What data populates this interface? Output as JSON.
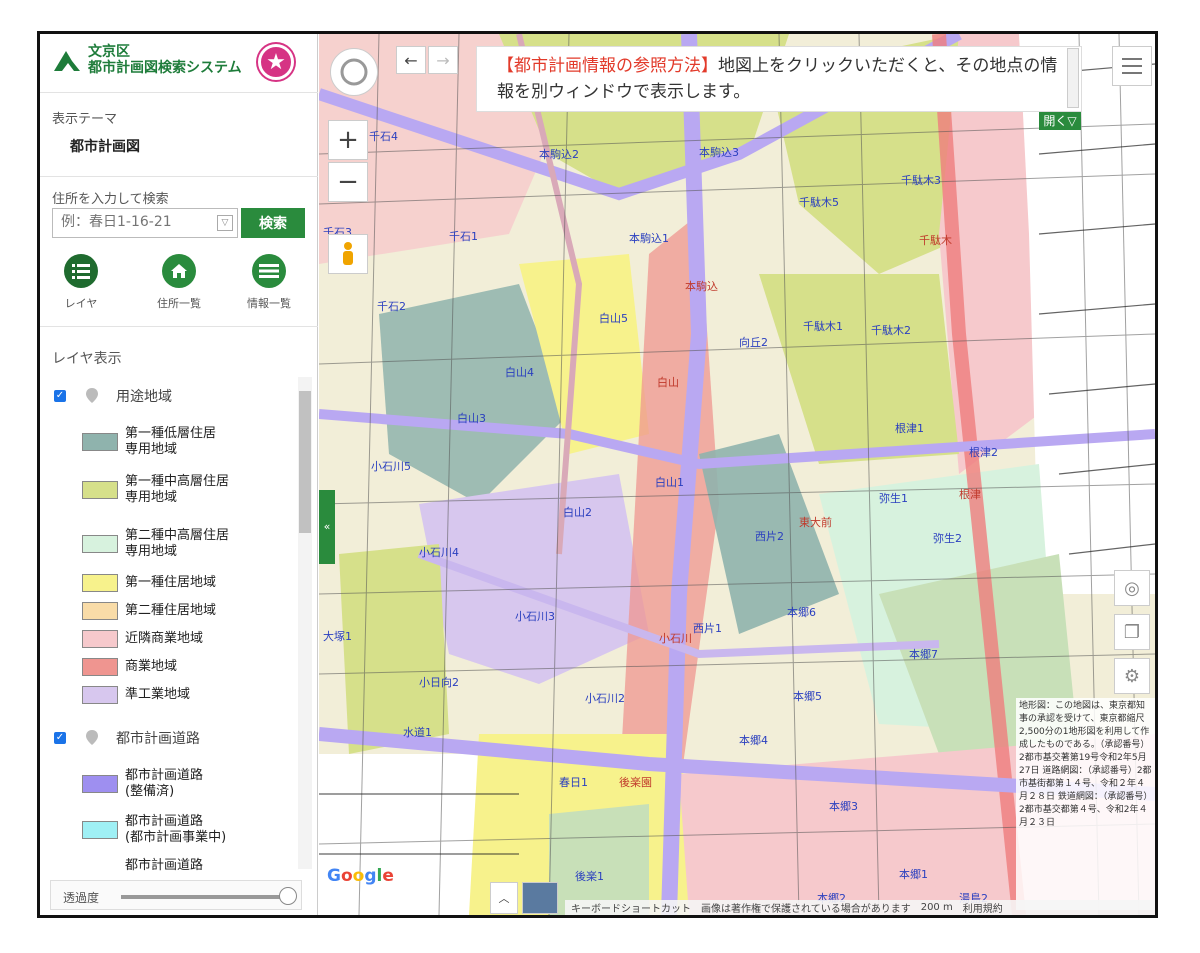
{
  "logo": {
    "line1": "文京区",
    "line2": "都市計画図検索システム"
  },
  "theme": {
    "label": "表示テーマ",
    "value": "都市計画図"
  },
  "search": {
    "label": "住所を入力して検索",
    "placeholder": "例：春日1-16-21",
    "button": "検索"
  },
  "nav": [
    {
      "label": "レイヤ",
      "icon": "list-icon"
    },
    {
      "label": "住所一覧",
      "icon": "home-icon"
    },
    {
      "label": "情報一覧",
      "icon": "info-list-icon"
    }
  ],
  "layers": {
    "title": "レイヤ表示",
    "groups": [
      {
        "name": "用途地域",
        "checked": true
      },
      {
        "name": "都市計画道路",
        "checked": true
      }
    ],
    "zoning": [
      {
        "label": "第一種低層住居\n専用地域",
        "color": "#8fb3ad"
      },
      {
        "label": "第一種中高層住居\n専用地域",
        "color": "#d6e08a"
      },
      {
        "label": "第二種中高層住居\n専用地域",
        "color": "#d7f2de"
      },
      {
        "label": "第一種住居地域",
        "color": "#f7f28c"
      },
      {
        "label": "第二種住居地域",
        "color": "#f9dca8"
      },
      {
        "label": "近隣商業地域",
        "color": "#f6c9cc"
      },
      {
        "label": "商業地域",
        "color": "#ef9590"
      },
      {
        "label": "準工業地域",
        "color": "#d7c7ee"
      }
    ],
    "roads": [
      {
        "label": "都市計画道路\n(整備済)",
        "color": "#9e8ff0"
      },
      {
        "label": "都市計画道路\n(都市計画事業中)",
        "color": "#9ff0f5"
      },
      {
        "label": "都市計画道路",
        "color": "#ffffff"
      }
    ]
  },
  "opacity": {
    "label": "透過度",
    "value": 1.0
  },
  "banner": {
    "highlight": "【都市計画情報の参照方法】",
    "text": "地図上をクリックいただくと、その地点の情報を別ウィンドウで表示します。"
  },
  "map": {
    "open_label": "開く▽",
    "zoom_in": "+",
    "zoom_out": "−",
    "google": "Google",
    "attribution": "地形図：この地図は、東京都知事の承認を受けて、東京都縮尺2,500分の1地形図を利用して作成したものである。（承認番号）2都市基交著第19号令和2年5月27日 道路網図：（承認番号）2都市基街都第１４号、令和２年４月２８日 鉄道網図：（承認番号）2都市基交都第４号、令和2年４月２３日",
    "bottom": [
      "キーボードショートカット",
      "画像は著作権で保護されている場合があります",
      "200 m",
      "利用規約"
    ],
    "labels": [
      {
        "text": "千石4"
      },
      {
        "text": "本駒込2"
      },
      {
        "text": "本駒込3"
      },
      {
        "text": "千駄木3"
      },
      {
        "text": "千駄木5"
      },
      {
        "text": "千石1"
      },
      {
        "text": "本駒込1"
      },
      {
        "text": "白山5"
      },
      {
        "text": "千駄木1"
      },
      {
        "text": "千駄木2"
      },
      {
        "text": "向丘2"
      },
      {
        "text": "白山4"
      },
      {
        "text": "白山3"
      },
      {
        "text": "根津1"
      },
      {
        "text": "根津2"
      },
      {
        "text": "白山2"
      },
      {
        "text": "小石川5"
      },
      {
        "text": "白山1"
      },
      {
        "text": "弥生1"
      },
      {
        "text": "西片2"
      },
      {
        "text": "弥生2"
      },
      {
        "text": "小石川4"
      },
      {
        "text": "小石川3"
      },
      {
        "text": "本郷6"
      },
      {
        "text": "西片1"
      },
      {
        "text": "本郷7"
      },
      {
        "text": "小石川2"
      },
      {
        "text": "本郷5"
      },
      {
        "text": "水道1"
      },
      {
        "text": "本郷4"
      },
      {
        "text": "春日1"
      },
      {
        "text": "本郷3"
      },
      {
        "text": "後楽1"
      },
      {
        "text": "本郷2"
      },
      {
        "text": "湯島2"
      },
      {
        "text": "千石2"
      },
      {
        "text": "千石3"
      },
      {
        "text": "本郷1"
      },
      {
        "text": "小日向2"
      },
      {
        "text": "大塚1"
      },
      {
        "text": "千駄木"
      },
      {
        "text": "根津"
      },
      {
        "text": "白山"
      },
      {
        "text": "本駒込"
      },
      {
        "text": "東大前"
      },
      {
        "text": "小石川"
      },
      {
        "text": "後楽園"
      }
    ]
  }
}
